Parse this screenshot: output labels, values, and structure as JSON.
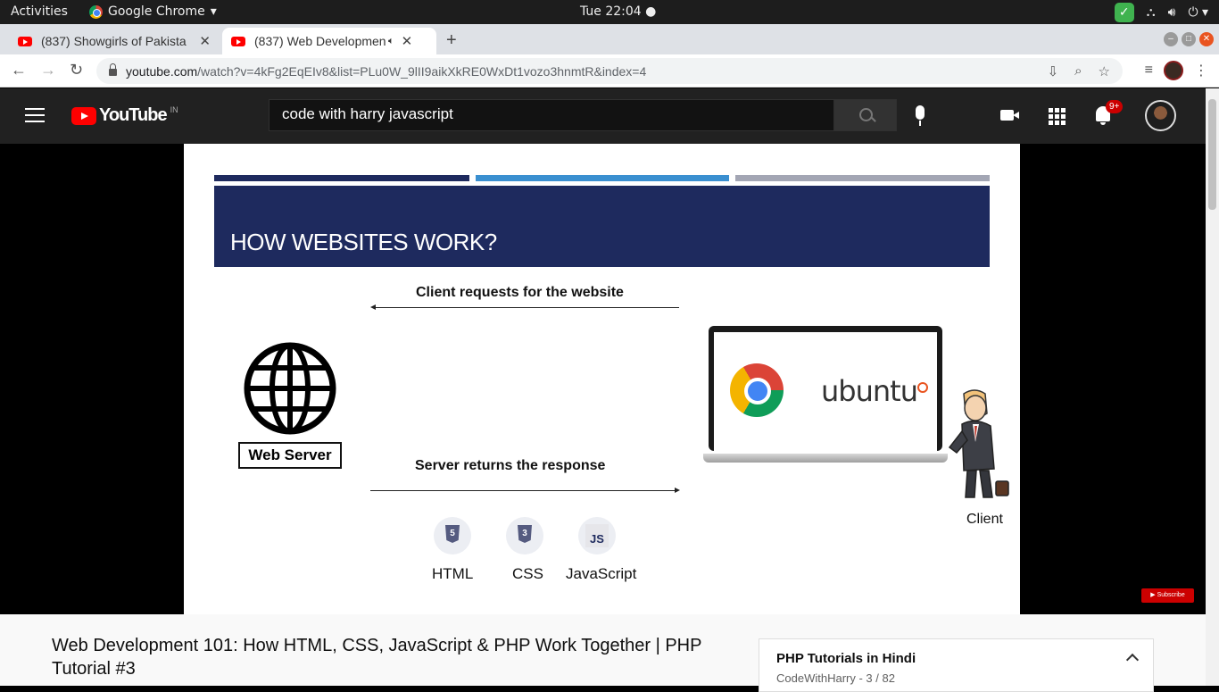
{
  "os_topbar": {
    "activities": "Activities",
    "app_name": "Google Chrome",
    "clock": "Tue 22:04"
  },
  "browser": {
    "tabs": [
      {
        "title": "(837) Showgirls of Pakista",
        "active": false
      },
      {
        "title": "(837) Web Developmen",
        "active": true
      }
    ],
    "url_domain": "youtube.com",
    "url_path": "/watch?v=4kFg2EqEIv8&list=PLu0W_9lII9aikXkRE0WxDt1vozo3hnmtR&index=4"
  },
  "youtube": {
    "logo_text": "YouTube",
    "country_code": "IN",
    "search_query": "code with harry javascript",
    "notification_count": "9+"
  },
  "slide": {
    "title": "HOW WEBSITES WORK?",
    "request_caption": "Client requests for the website",
    "response_caption": "Server returns the response",
    "server_label": "Web Server",
    "os_brand": "ubuntu",
    "client_label": "Client",
    "techs": [
      "HTML",
      "CSS",
      "JavaScript"
    ],
    "js_badge": "JS",
    "html_badge": "5",
    "css_badge": "3",
    "subscribe_watermark": "Subscribe",
    "colors": {
      "band": "#1e2a5e",
      "bar1": "#1e2a5e",
      "bar2": "#3a8fd0",
      "bar3": "#a3a6b4"
    }
  },
  "video_info": {
    "title": "Web Development 101: How HTML, CSS, JavaScript & PHP Work Together | PHP Tutorial #3"
  },
  "playlist": {
    "title": "PHP Tutorials in Hindi",
    "channel": "CodeWithHarry",
    "position": "3 / 82"
  }
}
